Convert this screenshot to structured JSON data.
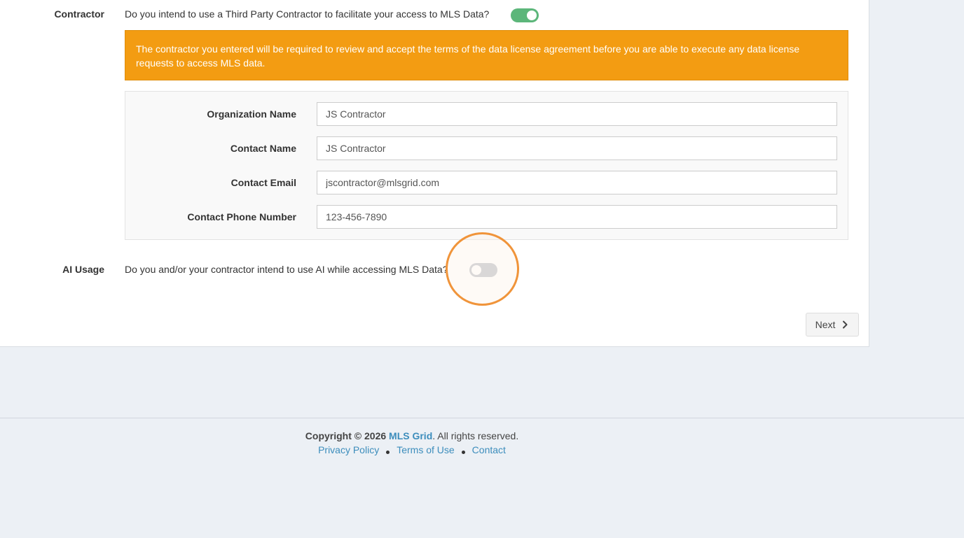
{
  "contractor": {
    "label": "Contractor",
    "question": "Do you intend to use a Third Party Contractor to facilitate your access to MLS Data?",
    "toggle_state": "on",
    "alert_text": "The contractor you entered will be required to review and accept the terms of the data license agreement before you are able to execute any data license requests to access MLS data.",
    "fields": [
      {
        "label": "Organization Name",
        "value": "JS Contractor"
      },
      {
        "label": "Contact Name",
        "value": "JS Contractor"
      },
      {
        "label": "Contact Email",
        "value": "jscontractor@mlsgrid.com"
      },
      {
        "label": "Contact Phone Number",
        "value": "123-456-7890"
      }
    ]
  },
  "ai_usage": {
    "label": "AI Usage",
    "question": "Do you and/or your contractor intend to use AI while accessing MLS Data?",
    "toggle_state": "off"
  },
  "actions": {
    "next_label": "Next",
    "next_icon": "chevron-right-icon"
  },
  "footer": {
    "copyright_prefix": "Copyright © 2026",
    "brand": "MLS Grid",
    "copyright_suffix": ". All rights reserved.",
    "links": [
      "Privacy Policy",
      "Terms of Use",
      "Contact"
    ]
  },
  "colors": {
    "alert_bg": "#f39c12",
    "toggle_on": "#5cb67a",
    "toggle_off": "#c7cad0",
    "link": "#3c8dbc",
    "highlight_ring": "#f0943a",
    "page_bg": "#ecf0f5"
  }
}
